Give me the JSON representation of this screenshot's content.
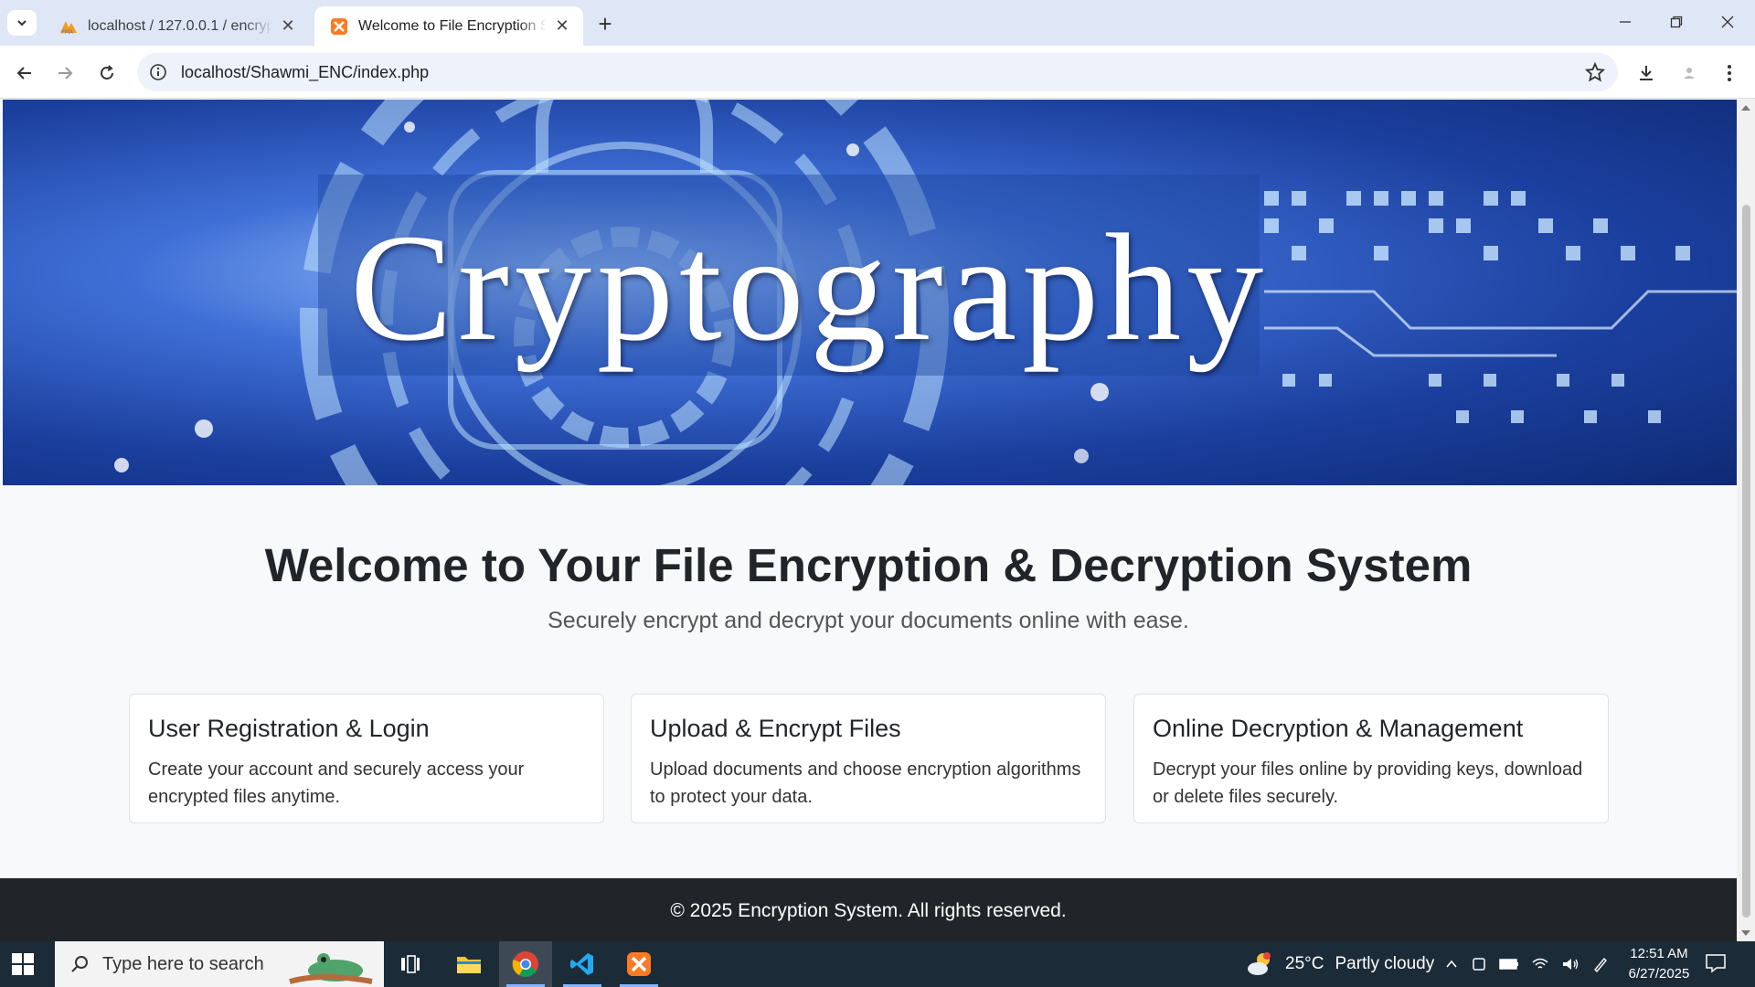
{
  "browser": {
    "tabs": [
      {
        "title": "localhost / 127.0.0.1 / encryptio",
        "active": false,
        "favicon": "phpmyadmin-icon"
      },
      {
        "title": "Welcome to File Encryption Syst",
        "active": true,
        "favicon": "xampp-icon"
      }
    ],
    "url": "localhost/Shawmi_ENC/index.php"
  },
  "page": {
    "hero_title": "Cryptography",
    "welcome_heading": "Welcome to Your File Encryption & Decryption System",
    "subtitle": "Securely encrypt and decrypt your documents online with ease.",
    "cards": [
      {
        "title": "User Registration & Login",
        "text": "Create your account and securely access your encrypted files anytime."
      },
      {
        "title": "Upload & Encrypt Files",
        "text": "Upload documents and choose encryption algorithms to protect your data."
      },
      {
        "title": "Online Decryption & Management",
        "text": "Decrypt your files online by providing keys, download or delete files securely."
      }
    ],
    "footer": "© 2025 Encryption System. All rights reserved."
  },
  "taskbar": {
    "search_placeholder": "Type here to search",
    "weather": {
      "temp": "25°C",
      "condition": "Partly cloudy"
    },
    "time": "12:51 AM",
    "date": "6/27/2025"
  },
  "colors": {
    "footer_bg": "#212529",
    "page_bg": "#f8f9fa",
    "taskbar_bg": "#1c2b38"
  }
}
